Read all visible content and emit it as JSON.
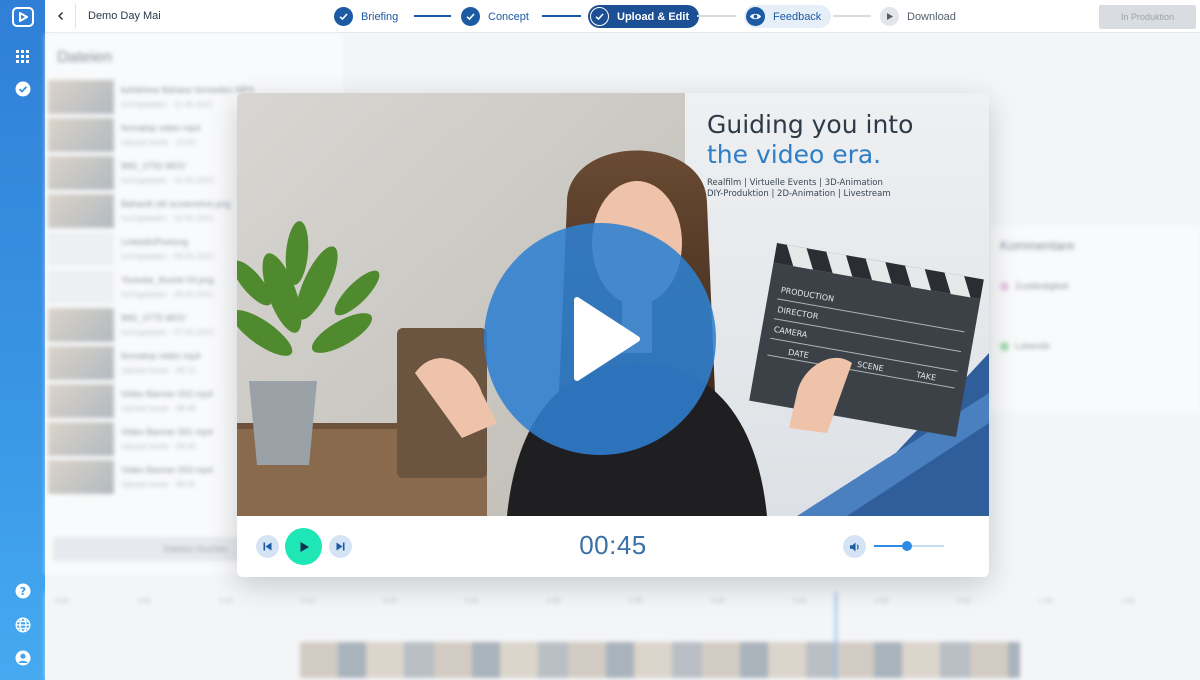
{
  "project": {
    "title": "Demo Day Mai"
  },
  "steps": [
    {
      "label": "Briefing",
      "state": "done"
    },
    {
      "label": "Concept",
      "state": "done"
    },
    {
      "label": "Upload & Edit",
      "state": "active"
    },
    {
      "label": "Feedback",
      "state": "next"
    },
    {
      "label": "Download",
      "state": "pending"
    }
  ],
  "production_button": "In Produktion",
  "files_panel": {
    "title": "Dateien",
    "files": [
      {
        "name": "kohlehine Bahara Vorstellen MP4",
        "meta": "hochgeladen · 11.05.2021"
      },
      {
        "name": "formatop video mp4",
        "meta": "Upload heute · 10:42"
      },
      {
        "name": "IMG_0792 MOV",
        "meta": "hochgeladen · 10.05.2021"
      },
      {
        "name": "Bahardt sitt screenshot.png",
        "meta": "hochgeladen · 10.05.2021"
      },
      {
        "name": "LinkedInPostung",
        "meta": "hochgeladen · 09.05.2021"
      },
      {
        "name": "Youtube_thumb 03.png",
        "meta": "hochgeladen · 08.05.2021"
      },
      {
        "name": "IMG_0775 MOV",
        "meta": "hochgeladen · 07.05.2021"
      },
      {
        "name": "formatop video mp4",
        "meta": "Upload heute · 09:12"
      },
      {
        "name": "Video Banner 002 mp4",
        "meta": "Upload heute · 08:48"
      },
      {
        "name": "Video Banner 001 mp4",
        "meta": "Upload heute · 08:40"
      },
      {
        "name": "Video Banner 003 mp4",
        "meta": "Upload heute · 08:31"
      }
    ],
    "delete_label": "Dateien löschen"
  },
  "comments_panel": {
    "title": "Kommentare",
    "items": [
      {
        "label": "Zuständigkeit",
        "color": "#d9a0d6"
      },
      {
        "label": "Lobende",
        "color": "#54c96a"
      }
    ]
  },
  "timeline": {
    "marks": [
      "0:00",
      "0:05",
      "0:10",
      "0:15",
      "0:20",
      "0:25",
      "0:30",
      "0:35",
      "0:40",
      "0:45",
      "0:50",
      "0:55",
      "1:00",
      "1:05"
    ]
  },
  "video": {
    "poster_heading_line1": "Guiding you into",
    "poster_heading_line2": "the video era.",
    "poster_sub_line1": "Realfilm | Virtuelle Events | 3D-Animation",
    "poster_sub_line2": "DIY-Produktion | 2D-Animation | Livestream",
    "clapper_labels": [
      "PRODUCTION",
      "DIRECTOR",
      "CAMERA",
      "DATE",
      "SCENE",
      "TAKE"
    ]
  },
  "player": {
    "time": "00:45",
    "volume": 0.47
  },
  "colors": {
    "accent": "#1c5aa3",
    "play": "#1ee6b5",
    "overlay_play": "#2f7fd0"
  },
  "icons": {
    "logo": "play-logo-icon",
    "apps": "grid-icon",
    "tasks": "check-circle-icon",
    "help": "help-icon",
    "language": "globe-icon",
    "account": "user-icon"
  }
}
